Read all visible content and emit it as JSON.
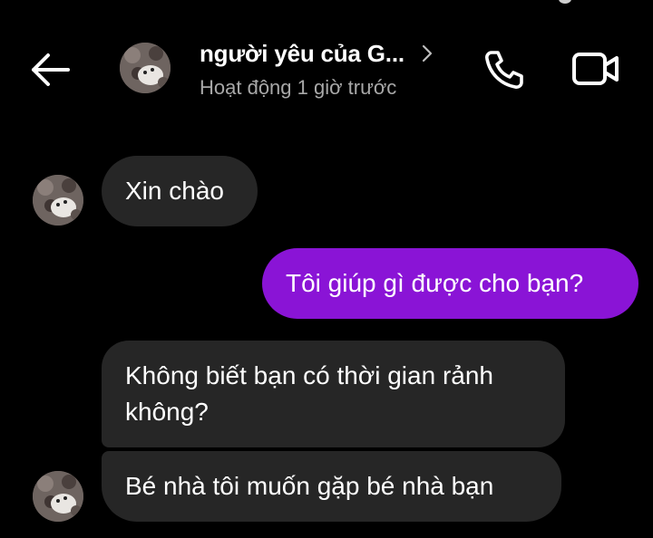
{
  "header": {
    "contact_name": "người yêu của G...",
    "status": "Hoạt động 1 giờ trước",
    "icons": {
      "back": "arrow-left-icon",
      "details": "chevron-right-icon",
      "call": "phone-icon",
      "video": "video-camera-icon"
    }
  },
  "messages": [
    {
      "direction": "incoming",
      "text": "Xin chào"
    },
    {
      "direction": "outgoing",
      "text": "Tôi giúp gì được cho bạn?"
    },
    {
      "direction": "incoming",
      "text": "Không biết bạn có thời gian rảnh không?"
    },
    {
      "direction": "incoming",
      "text": "Bé nhà tôi muốn gặp bé nhà bạn"
    }
  ],
  "colors": {
    "background": "#000000",
    "incoming_bubble": "#262626",
    "outgoing_bubble": "#8a14d6",
    "status_text": "#a8a8a8"
  }
}
